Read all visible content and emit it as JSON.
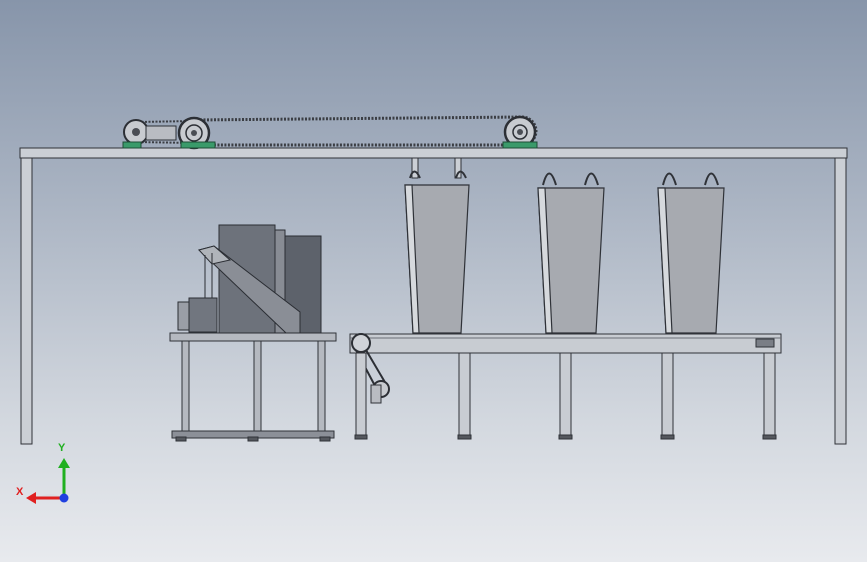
{
  "viewport": {
    "background_top": "#8795aa",
    "background_bottom": "#e8eaee"
  },
  "colors": {
    "frame": "#c8ccd2",
    "frame_edge": "#2f3238",
    "hopper": "#a4a7ad",
    "machine_dark": "#6b7079",
    "sprocket": "#5e6168",
    "foot_green": "#3a9a6a",
    "axis_x": "#e02020",
    "axis_y": "#20b020",
    "axis_z": "#2040e0"
  },
  "scene": {
    "objects": [
      "overhead-frame",
      "chain-conveyor",
      "hopper-bins",
      "belt-conveyor",
      "cutting-machine",
      "machine-table"
    ]
  },
  "triad": {
    "x_label": "X",
    "y_label": "Y",
    "icon": "axis-triad-icon"
  }
}
